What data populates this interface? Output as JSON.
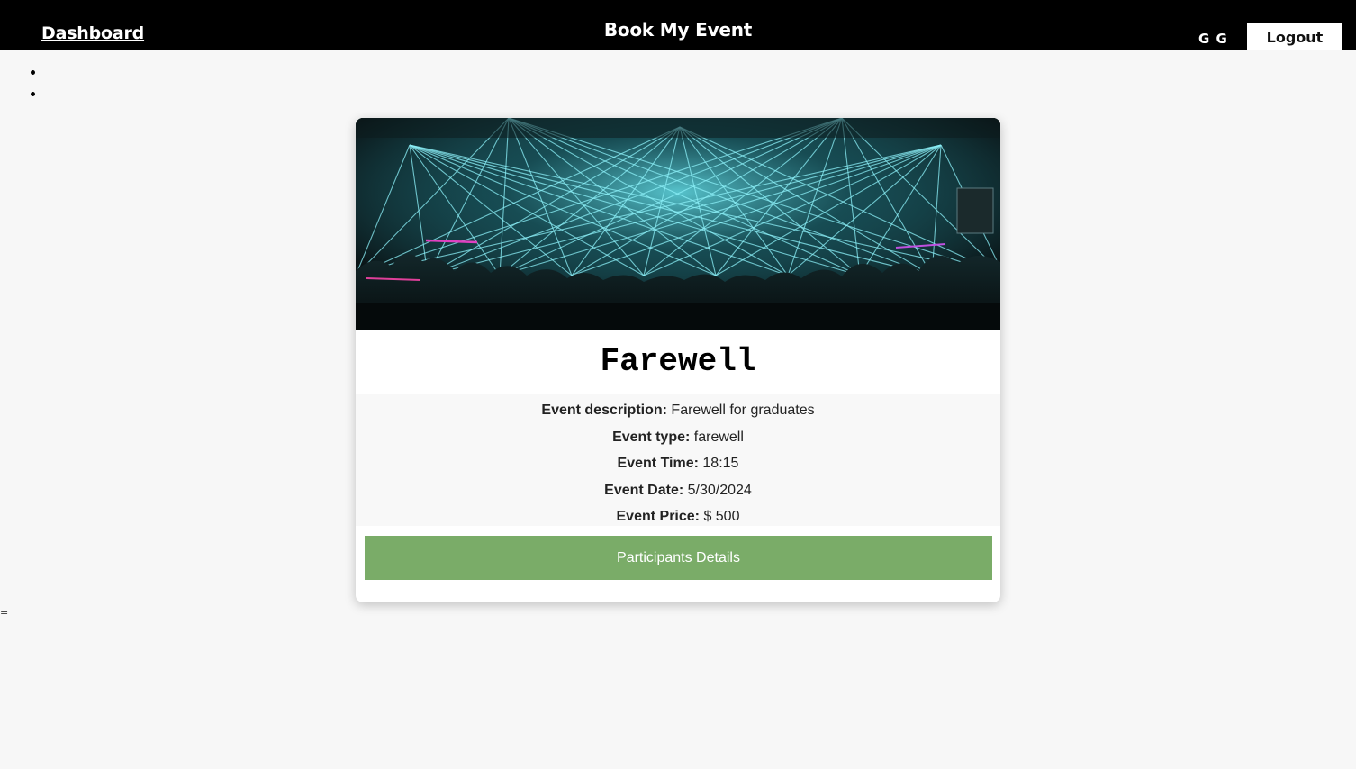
{
  "header": {
    "dashboard_link": "Dashboard",
    "brand": "Book My Event",
    "user_initials": "G G",
    "logout_label": "Logout"
  },
  "stray_mark": "=",
  "event": {
    "image_icon": "event-photo-lasers",
    "title": "Farewell",
    "description_label": "Event description:",
    "description": "Farewell for graduates",
    "type_label": "Event type:",
    "type": "farewell",
    "time_label": "Event Time:",
    "time": "18:15",
    "date_label": "Event Date:",
    "date": "5/30/2024",
    "price_label": "Event Price:",
    "price": "$ 500",
    "participants_button": "Participants Details"
  },
  "colors": {
    "topbar": "#000000",
    "page_background": "#f7f7f7",
    "button_green": "#7aac68",
    "laser_cyan": "#7fe6f0"
  }
}
